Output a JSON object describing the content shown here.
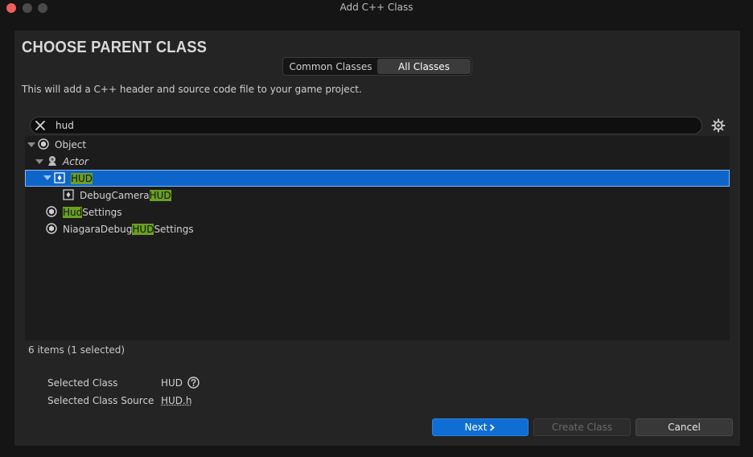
{
  "window": {
    "title": "Add C++ Class"
  },
  "header": {
    "title": "CHOOSE PARENT CLASS"
  },
  "tabs": [
    {
      "label": "Common Classes",
      "active": false
    },
    {
      "label": "All Classes",
      "active": true
    }
  ],
  "description": "This will add a C++ header and source code file to your game project.",
  "search": {
    "value": "hud",
    "clear_icon": "close-icon",
    "settings_icon": "gear-icon"
  },
  "tree": {
    "highlight_color": "#6aa022",
    "selected_color": "#0d65c9",
    "items": [
      {
        "pre": "Object",
        "match": "",
        "post": "",
        "depth": 0,
        "expanded": true,
        "icon": "object-class-icon"
      },
      {
        "pre": "Actor",
        "match": "",
        "post": "",
        "depth": 1,
        "expanded": true,
        "italic": true,
        "icon": "actor-class-icon"
      },
      {
        "pre": "",
        "match": "HUD",
        "post": "",
        "depth": 2,
        "expanded": true,
        "selected": true,
        "icon": "hud-class-icon"
      },
      {
        "pre": "DebugCamera",
        "match": "HUD",
        "post": "",
        "depth": 3,
        "icon": "hud-class-icon"
      },
      {
        "pre": "",
        "match": "Hud",
        "post": "Settings",
        "depth": 1,
        "icon": "object-class-icon"
      },
      {
        "pre": "NiagaraDebug",
        "match": "HUD",
        "post": "Settings",
        "depth": 1,
        "icon": "object-class-icon"
      }
    ]
  },
  "status": {
    "count": "6 items (1 selected)"
  },
  "selection": {
    "class_label": "Selected Class",
    "class_value": "HUD",
    "source_label": "Selected Class Source",
    "source_value": "HUD.h"
  },
  "buttons": {
    "next": "Next",
    "create": "Create Class",
    "cancel": "Cancel"
  }
}
